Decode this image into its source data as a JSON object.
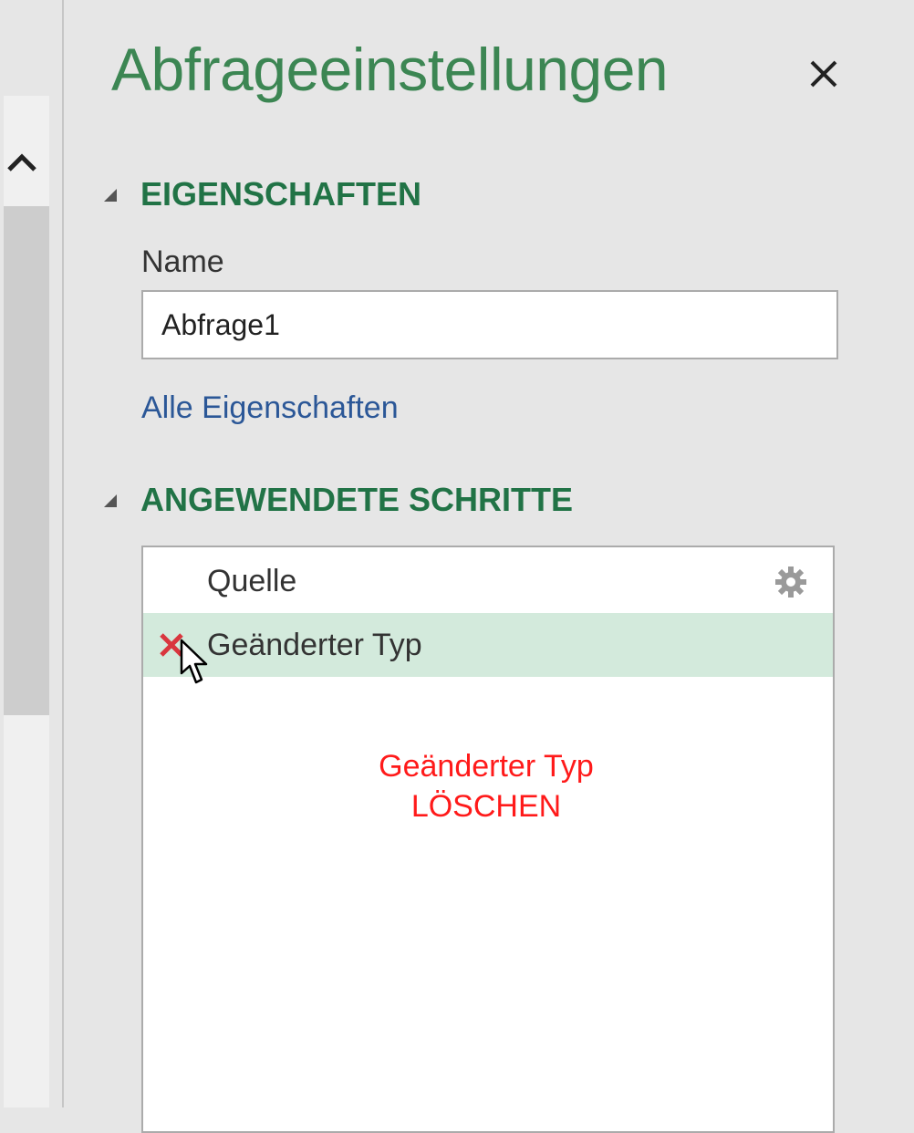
{
  "panel": {
    "title": "Abfrageeinstellungen",
    "close_icon": "close-icon"
  },
  "properties": {
    "heading": "EIGENSCHAFTEN",
    "name_label": "Name",
    "name_value": "Abfrage1",
    "all_properties_link": "Alle Eigenschaften"
  },
  "applied_steps": {
    "heading": "ANGEWENDETE SCHRITTE",
    "items": [
      {
        "label": "Quelle",
        "icon": "gear-icon",
        "selected": false
      },
      {
        "label": "Geänderter Typ",
        "icon": "delete-icon",
        "selected": true
      }
    ]
  },
  "annotation": {
    "line1": "Geänderter Typ",
    "line2": "LÖSCHEN"
  },
  "colors": {
    "accent_green": "#217346",
    "title_green": "#3c8653",
    "selected_row": "#d3eadc",
    "link_blue": "#2b5797",
    "annotation_red": "#ff1a1a",
    "delete_red": "#d9363e"
  }
}
